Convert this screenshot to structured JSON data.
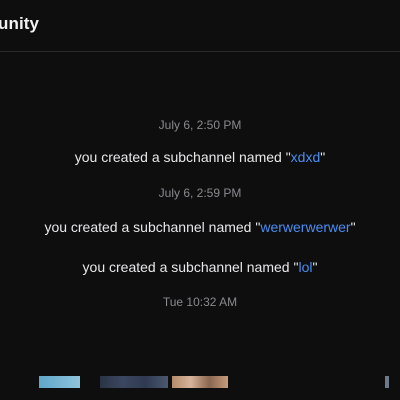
{
  "header": {
    "title": "unity"
  },
  "feed": {
    "entries": [
      {
        "type": "timestamp",
        "text": "July 6, 2:50 PM"
      },
      {
        "type": "event",
        "prefix": "you created a subchannel named \"",
        "channel": "xdxd",
        "suffix": "\""
      },
      {
        "type": "timestamp",
        "text": "July 6, 2:59 PM"
      },
      {
        "type": "event",
        "prefix": "you created a subchannel named \"",
        "channel": "werwerwerwer",
        "suffix": "\""
      },
      {
        "type": "event",
        "prefix": "you created a subchannel named \"",
        "channel": "lol",
        "suffix": "\""
      },
      {
        "type": "timestamp",
        "text": "Tue 10:32 AM"
      }
    ]
  },
  "colors": {
    "background": "#0e0e0f",
    "text": "#e8e8ea",
    "timestamp": "#8a8a8e",
    "channel_link": "#4a8df0",
    "divider": "#2a2a2d"
  }
}
